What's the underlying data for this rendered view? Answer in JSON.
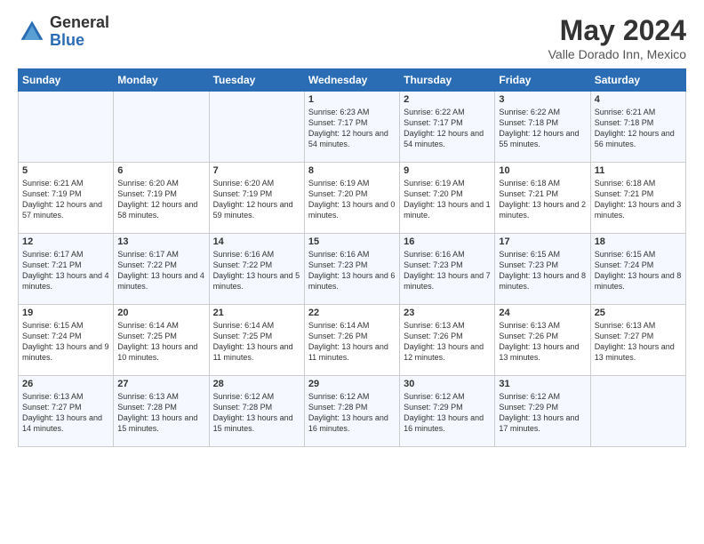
{
  "logo": {
    "general": "General",
    "blue": "Blue"
  },
  "title": "May 2024",
  "subtitle": "Valle Dorado Inn, Mexico",
  "days_header": [
    "Sunday",
    "Monday",
    "Tuesday",
    "Wednesday",
    "Thursday",
    "Friday",
    "Saturday"
  ],
  "weeks": [
    [
      {
        "num": "",
        "sunrise": "",
        "sunset": "",
        "daylight": ""
      },
      {
        "num": "",
        "sunrise": "",
        "sunset": "",
        "daylight": ""
      },
      {
        "num": "",
        "sunrise": "",
        "sunset": "",
        "daylight": ""
      },
      {
        "num": "1",
        "sunrise": "Sunrise: 6:23 AM",
        "sunset": "Sunset: 7:17 PM",
        "daylight": "Daylight: 12 hours and 54 minutes."
      },
      {
        "num": "2",
        "sunrise": "Sunrise: 6:22 AM",
        "sunset": "Sunset: 7:17 PM",
        "daylight": "Daylight: 12 hours and 54 minutes."
      },
      {
        "num": "3",
        "sunrise": "Sunrise: 6:22 AM",
        "sunset": "Sunset: 7:18 PM",
        "daylight": "Daylight: 12 hours and 55 minutes."
      },
      {
        "num": "4",
        "sunrise": "Sunrise: 6:21 AM",
        "sunset": "Sunset: 7:18 PM",
        "daylight": "Daylight: 12 hours and 56 minutes."
      }
    ],
    [
      {
        "num": "5",
        "sunrise": "Sunrise: 6:21 AM",
        "sunset": "Sunset: 7:19 PM",
        "daylight": "Daylight: 12 hours and 57 minutes."
      },
      {
        "num": "6",
        "sunrise": "Sunrise: 6:20 AM",
        "sunset": "Sunset: 7:19 PM",
        "daylight": "Daylight: 12 hours and 58 minutes."
      },
      {
        "num": "7",
        "sunrise": "Sunrise: 6:20 AM",
        "sunset": "Sunset: 7:19 PM",
        "daylight": "Daylight: 12 hours and 59 minutes."
      },
      {
        "num": "8",
        "sunrise": "Sunrise: 6:19 AM",
        "sunset": "Sunset: 7:20 PM",
        "daylight": "Daylight: 13 hours and 0 minutes."
      },
      {
        "num": "9",
        "sunrise": "Sunrise: 6:19 AM",
        "sunset": "Sunset: 7:20 PM",
        "daylight": "Daylight: 13 hours and 1 minute."
      },
      {
        "num": "10",
        "sunrise": "Sunrise: 6:18 AM",
        "sunset": "Sunset: 7:21 PM",
        "daylight": "Daylight: 13 hours and 2 minutes."
      },
      {
        "num": "11",
        "sunrise": "Sunrise: 6:18 AM",
        "sunset": "Sunset: 7:21 PM",
        "daylight": "Daylight: 13 hours and 3 minutes."
      }
    ],
    [
      {
        "num": "12",
        "sunrise": "Sunrise: 6:17 AM",
        "sunset": "Sunset: 7:21 PM",
        "daylight": "Daylight: 13 hours and 4 minutes."
      },
      {
        "num": "13",
        "sunrise": "Sunrise: 6:17 AM",
        "sunset": "Sunset: 7:22 PM",
        "daylight": "Daylight: 13 hours and 4 minutes."
      },
      {
        "num": "14",
        "sunrise": "Sunrise: 6:16 AM",
        "sunset": "Sunset: 7:22 PM",
        "daylight": "Daylight: 13 hours and 5 minutes."
      },
      {
        "num": "15",
        "sunrise": "Sunrise: 6:16 AM",
        "sunset": "Sunset: 7:23 PM",
        "daylight": "Daylight: 13 hours and 6 minutes."
      },
      {
        "num": "16",
        "sunrise": "Sunrise: 6:16 AM",
        "sunset": "Sunset: 7:23 PM",
        "daylight": "Daylight: 13 hours and 7 minutes."
      },
      {
        "num": "17",
        "sunrise": "Sunrise: 6:15 AM",
        "sunset": "Sunset: 7:23 PM",
        "daylight": "Daylight: 13 hours and 8 minutes."
      },
      {
        "num": "18",
        "sunrise": "Sunrise: 6:15 AM",
        "sunset": "Sunset: 7:24 PM",
        "daylight": "Daylight: 13 hours and 8 minutes."
      }
    ],
    [
      {
        "num": "19",
        "sunrise": "Sunrise: 6:15 AM",
        "sunset": "Sunset: 7:24 PM",
        "daylight": "Daylight: 13 hours and 9 minutes."
      },
      {
        "num": "20",
        "sunrise": "Sunrise: 6:14 AM",
        "sunset": "Sunset: 7:25 PM",
        "daylight": "Daylight: 13 hours and 10 minutes."
      },
      {
        "num": "21",
        "sunrise": "Sunrise: 6:14 AM",
        "sunset": "Sunset: 7:25 PM",
        "daylight": "Daylight: 13 hours and 11 minutes."
      },
      {
        "num": "22",
        "sunrise": "Sunrise: 6:14 AM",
        "sunset": "Sunset: 7:26 PM",
        "daylight": "Daylight: 13 hours and 11 minutes."
      },
      {
        "num": "23",
        "sunrise": "Sunrise: 6:13 AM",
        "sunset": "Sunset: 7:26 PM",
        "daylight": "Daylight: 13 hours and 12 minutes."
      },
      {
        "num": "24",
        "sunrise": "Sunrise: 6:13 AM",
        "sunset": "Sunset: 7:26 PM",
        "daylight": "Daylight: 13 hours and 13 minutes."
      },
      {
        "num": "25",
        "sunrise": "Sunrise: 6:13 AM",
        "sunset": "Sunset: 7:27 PM",
        "daylight": "Daylight: 13 hours and 13 minutes."
      }
    ],
    [
      {
        "num": "26",
        "sunrise": "Sunrise: 6:13 AM",
        "sunset": "Sunset: 7:27 PM",
        "daylight": "Daylight: 13 hours and 14 minutes."
      },
      {
        "num": "27",
        "sunrise": "Sunrise: 6:13 AM",
        "sunset": "Sunset: 7:28 PM",
        "daylight": "Daylight: 13 hours and 15 minutes."
      },
      {
        "num": "28",
        "sunrise": "Sunrise: 6:12 AM",
        "sunset": "Sunset: 7:28 PM",
        "daylight": "Daylight: 13 hours and 15 minutes."
      },
      {
        "num": "29",
        "sunrise": "Sunrise: 6:12 AM",
        "sunset": "Sunset: 7:28 PM",
        "daylight": "Daylight: 13 hours and 16 minutes."
      },
      {
        "num": "30",
        "sunrise": "Sunrise: 6:12 AM",
        "sunset": "Sunset: 7:29 PM",
        "daylight": "Daylight: 13 hours and 16 minutes."
      },
      {
        "num": "31",
        "sunrise": "Sunrise: 6:12 AM",
        "sunset": "Sunset: 7:29 PM",
        "daylight": "Daylight: 13 hours and 17 minutes."
      },
      {
        "num": "",
        "sunrise": "",
        "sunset": "",
        "daylight": ""
      }
    ]
  ]
}
